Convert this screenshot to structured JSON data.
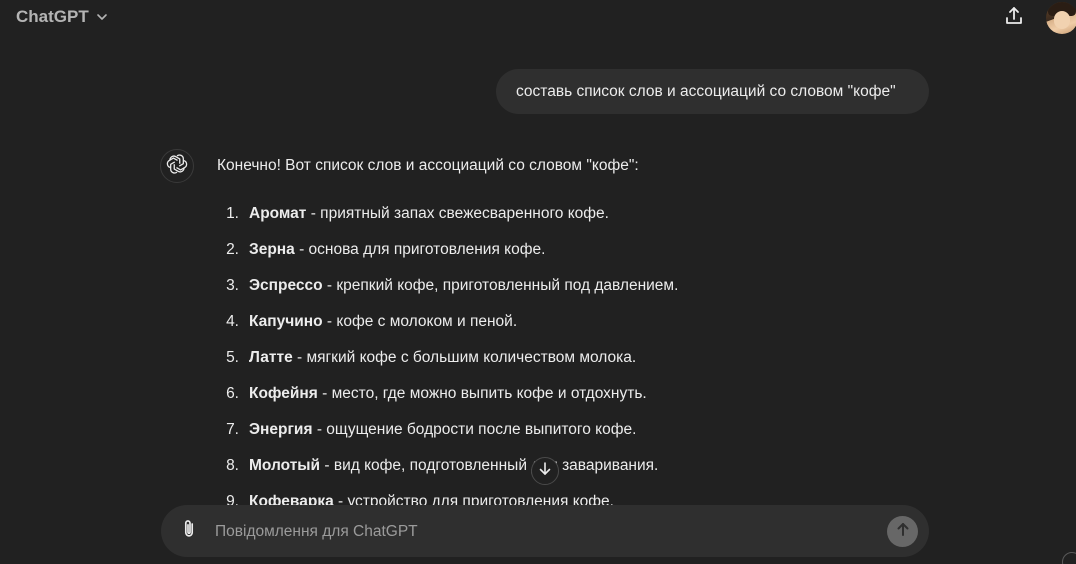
{
  "header": {
    "model_name": "ChatGPT",
    "chevron_icon": "chevron-down-icon",
    "share_icon": "share-upload-icon",
    "avatar_icon": "user-avatar"
  },
  "conversation": {
    "user_message": "составь список слов и ассоциаций со словом \"кофе\"",
    "assistant": {
      "avatar_icon": "openai-logo-icon",
      "intro": "Конечно! Вот список слов и ассоциаций со словом \"кофе\":",
      "items": [
        {
          "num": "1.",
          "term": "Аромат",
          "desc": " - приятный запах свежесваренного кофе."
        },
        {
          "num": "2.",
          "term": "Зерна",
          "desc": " - основа для приготовления кофе."
        },
        {
          "num": "3.",
          "term": "Эспрессо",
          "desc": " - крепкий кофе, приготовленный под давлением."
        },
        {
          "num": "4.",
          "term": "Капучино",
          "desc": " - кофе с молоком и пеной."
        },
        {
          "num": "5.",
          "term": "Латте",
          "desc": " - мягкий кофе с большим количеством молока."
        },
        {
          "num": "6.",
          "term": "Кофейня",
          "desc": " - место, где можно выпить кофе и отдохнуть."
        },
        {
          "num": "7.",
          "term": "Энергия",
          "desc": " - ощущение бодрости после выпитого кофе."
        },
        {
          "num": "8.",
          "term": "Молотый",
          "desc": " - вид кофе, подготовленный для заваривания."
        },
        {
          "num": "9.",
          "term": "Кофеварка",
          "desc": " - устройство для приготовления кофе."
        }
      ]
    }
  },
  "scroll_down_icon": "arrow-down-icon",
  "composer": {
    "placeholder": "Повідомлення для ChatGPT",
    "value": "",
    "attach_icon": "paperclip-icon",
    "send_icon": "arrow-up-icon"
  },
  "colors": {
    "background": "#212121",
    "bubble": "#2f2f2f",
    "text": "#ececec",
    "muted": "#b4b4b4",
    "send_button": "#676767"
  }
}
